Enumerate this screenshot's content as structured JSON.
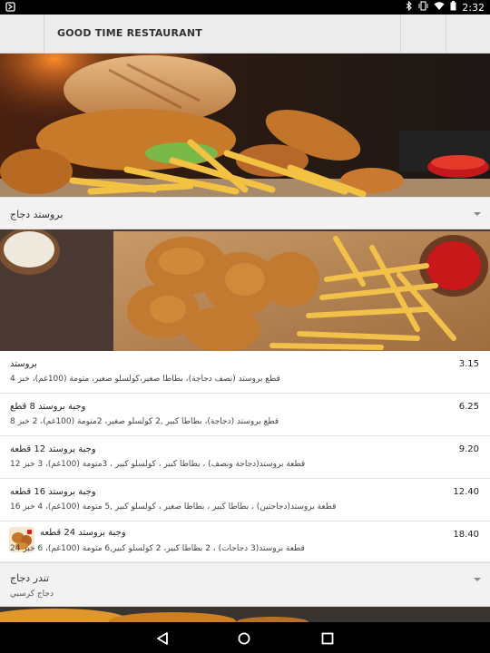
{
  "status_bar": {
    "time": "2:32",
    "icons": [
      "app-icon",
      "bluetooth-icon",
      "vibrate-icon",
      "wifi-icon",
      "battery-icon"
    ]
  },
  "app_bar": {
    "title": "GOOD TIME RESTAURANT"
  },
  "sections": [
    {
      "name": "بروستد دجاج",
      "subtitle": ""
    },
    {
      "name": "تندر دجاج",
      "subtitle": "دجاج كرسبي"
    }
  ],
  "items": [
    {
      "name": "بروستد",
      "desc": "قطع بروستد (نصف دجاجة)، بطاطا صغير،كولسلو صغير، متومة (100غم)، خبز 4",
      "price": "3.15"
    },
    {
      "name": "وجبة بروستد 8 قطع",
      "desc": "قطع بروستد (دجاجة)، بطاطا كبير ,2 كولسلو صغير، 2متومة (100غم)، 2 خبز 8",
      "price": "6.25"
    },
    {
      "name": "وجبة بروستد 12 قطعة",
      "desc": "قطعة بروستد(دجاجة ونصف) ، بطاطا كبير ، كولسلو كبير ، 3متومة (100غم)، 3 خبز 12",
      "price": "9.20"
    },
    {
      "name": "وجبة بروستد 16 قطعه",
      "desc": "قطعة بروستد(دجاجتين) ، بطاطا كبير ، بطاطا صغير ، كولسلو كبير ,5 متومة (100غم)، 4 خبز 16",
      "price": "12.40"
    },
    {
      "name": "وجبة بروستد 24 قطعه",
      "desc": "قطعة بروستد(3 دجاجات) ، 2 بطاطا كبير، 2 كولسلو كبير,6 متومة (100غم)، 6 خبز 24",
      "price": "18.40"
    }
  ],
  "colors": {
    "app_bar": "#ececec",
    "section_bg": "#f2f2f2",
    "status_bar": "#000000",
    "nav_bar": "#000000"
  }
}
